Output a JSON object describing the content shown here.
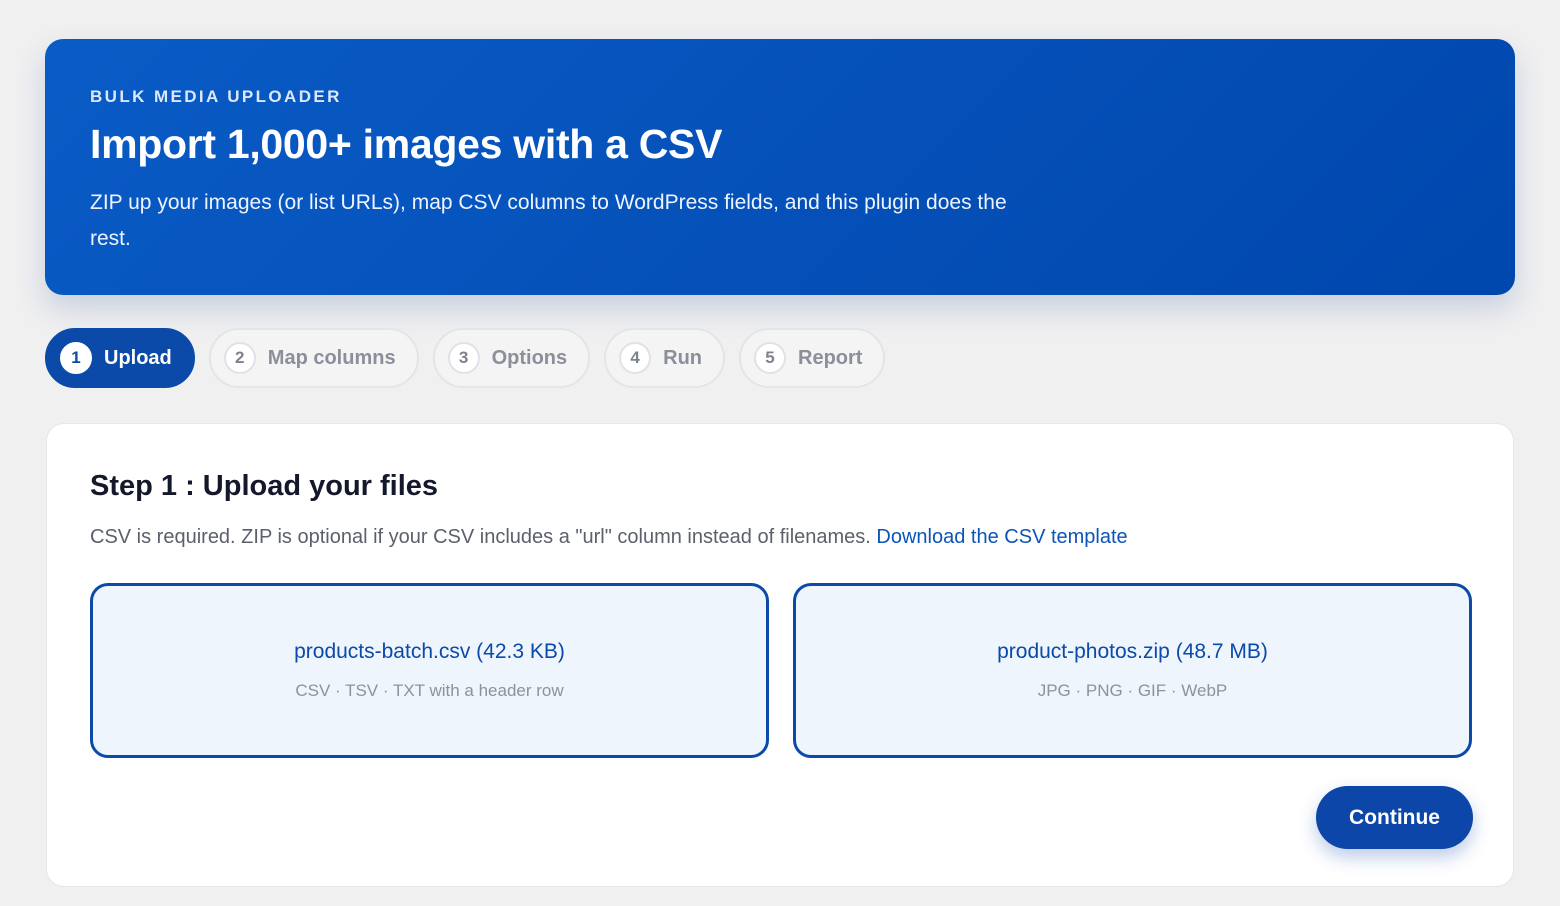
{
  "hero": {
    "eyebrow": "BULK MEDIA UPLOADER",
    "title": "Import 1,000+ images with a CSV",
    "subtitle": "ZIP up your images (or list URLs), map CSV columns to WordPress fields, and this plugin does the rest."
  },
  "steps": [
    {
      "num": "1",
      "label": "Upload",
      "active": true
    },
    {
      "num": "2",
      "label": "Map columns",
      "active": false
    },
    {
      "num": "3",
      "label": "Options",
      "active": false
    },
    {
      "num": "4",
      "label": "Run",
      "active": false
    },
    {
      "num": "5",
      "label": "Report",
      "active": false
    }
  ],
  "card": {
    "title": "Step 1 : Upload your files",
    "description": "CSV is required. ZIP is optional if your CSV includes a \"url\" column instead of filenames.",
    "template_link": "Download the CSV template",
    "csv_drop": {
      "filename": "products-batch.csv (42.3 KB)",
      "hint": "CSV · TSV · TXT with a header row"
    },
    "zip_drop": {
      "filename": "product-photos.zip (48.7 MB)",
      "hint": "JPG · PNG · GIF · WebP"
    },
    "continue_label": "Continue"
  },
  "colors": {
    "accent": "#0b4aa8",
    "hero_start": "#0a5bc6",
    "hero_end": "#0047ad",
    "drop_bg": "#eef5fd"
  }
}
